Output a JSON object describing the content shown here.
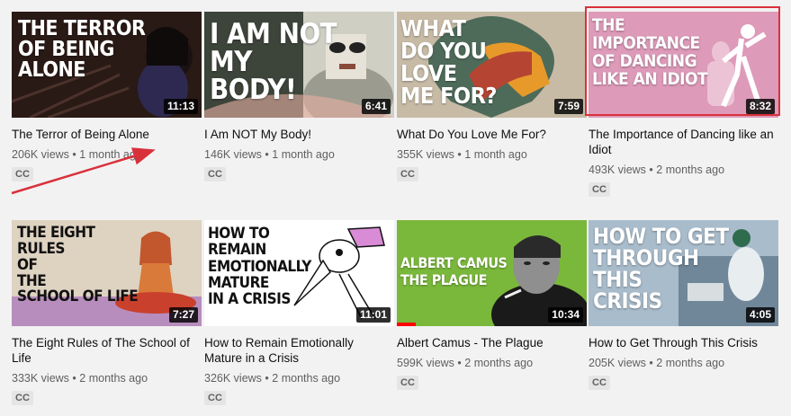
{
  "videos": [
    {
      "title": "The Terror of Being Alone",
      "thumb_text": "THE TERROR\nOF BEING\nALONE",
      "duration": "11:13",
      "views": "206K views",
      "age": "1 month ago",
      "cc": "CC",
      "bg": "#2a1a16"
    },
    {
      "title": "I Am NOT My Body!",
      "thumb_text": "I AM NOT\nMY\nBODY!",
      "duration": "6:41",
      "views": "146K views",
      "age": "1 month ago",
      "cc": "CC",
      "bg": "#3d443a"
    },
    {
      "title": "What Do You Love Me For?",
      "thumb_text": "WHAT\nDO YOU\nLOVE\nME FOR?",
      "duration": "7:59",
      "views": "355K views",
      "age": "1 month ago",
      "cc": "CC",
      "bg": "#c7bba6"
    },
    {
      "title": "The Importance of Dancing like an Idiot",
      "thumb_text": "THE\nIMPORTANCE\nOF DANCING\nLIKE AN IDIOT",
      "duration": "8:32",
      "views": "493K views",
      "age": "2 months ago",
      "cc": "CC",
      "bg": "#dd9ab9"
    },
    {
      "title": "The Eight Rules of The School of Life",
      "thumb_text": "THE EIGHT\nRULES\nOF\nTHE\nSCHOOL OF LIFE",
      "duration": "7:27",
      "views": "333K views",
      "age": "2 months ago",
      "cc": "CC",
      "bg": "#ded2c1"
    },
    {
      "title": "How to Remain Emotionally Mature in a Crisis",
      "thumb_text": "HOW TO\nREMAIN\nEMOTIONALLY\nMATURE\nIN A CRISIS",
      "duration": "11:01",
      "views": "326K views",
      "age": "2 months ago",
      "cc": "CC",
      "bg": "#ffffff"
    },
    {
      "title": "Albert Camus - The Plague",
      "thumb_text": "ALBERT CAMUS\nTHE PLAGUE",
      "duration": "10:34",
      "views": "599K views",
      "age": "2 months ago",
      "cc": "CC",
      "bg": "#7ab83b",
      "progress": 0.1
    },
    {
      "title": "How to Get Through This Crisis",
      "thumb_text": "HOW TO GET\nTHROUGH\nTHIS\nCRISIS",
      "duration": "4:05",
      "views": "205K views",
      "age": "2 months ago",
      "cc": "CC",
      "bg": "#8da3b5"
    }
  ],
  "separator": "•",
  "colors": {
    "annotation": "#d9313c",
    "text_primary": "#0f0f0f",
    "text_secondary": "#606060"
  }
}
